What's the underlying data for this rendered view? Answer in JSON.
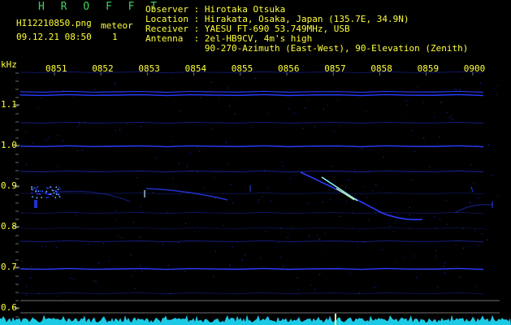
{
  "header": {
    "app_name": "H R O F F T",
    "file_name": "HI12210850.png",
    "meteor_label": "meteor",
    "meteor_count": "1",
    "datetime": "09.12.21 08:50",
    "observer": "Observer : Hirotaka Otsuka",
    "location": "Location : Hirakata, Osaka, Japan (135.7E, 34.9N)",
    "receiver": "Receiver : YAESU FT-690 53.749MHz, USB",
    "antenna": "Antenna  : 2el-HB9CV, 4m's high",
    "antenna_detail": "           90-270-Azimuth (East-West), 90-Elevation (Zenith)"
  },
  "axis": {
    "unit": "kHz",
    "time_ticks": [
      "0851",
      "0852",
      "0853",
      "0854",
      "0855",
      "0856",
      "0857",
      "0858",
      "0859",
      "0900"
    ],
    "freq_ticks": [
      "1.1",
      "1.0",
      "0.9",
      "0.8",
      "0.7",
      "0.6"
    ]
  },
  "colors": {
    "background": "#000000",
    "text": "#ffff3c",
    "title": "#3fd15f",
    "signal": "#2a3cff",
    "meteor_head": "#8fffff",
    "noise_floor": "#1fe0ff"
  }
}
